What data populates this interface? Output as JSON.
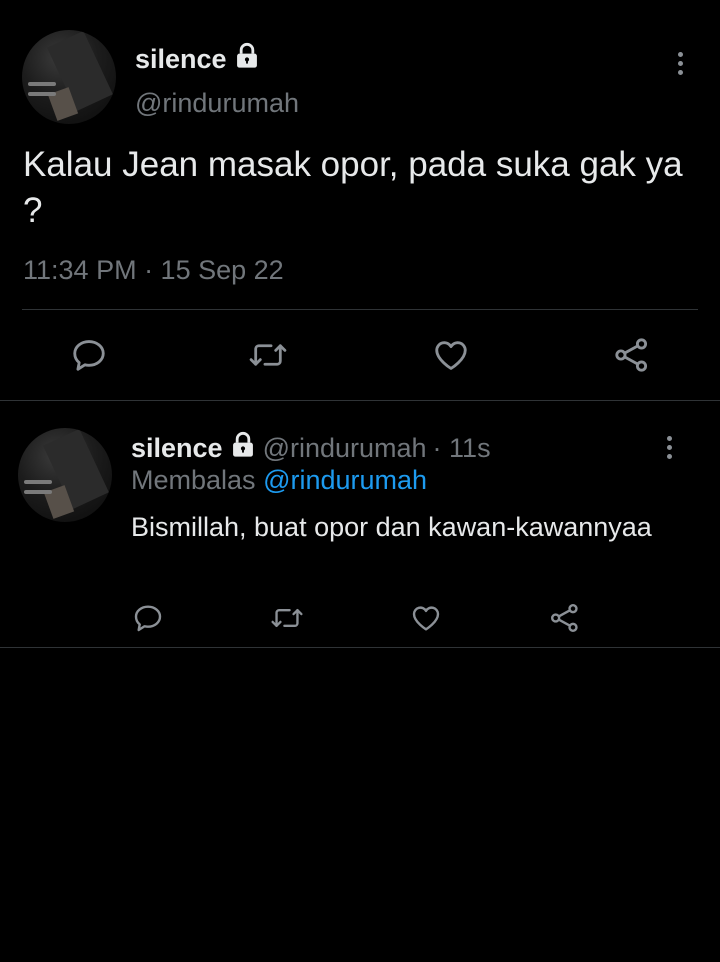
{
  "main_tweet": {
    "display_name": "silence",
    "handle": "@rindurumah",
    "text": "Kalau Jean masak opor, pada suka gak ya ?",
    "timestamp": "11:34 PM · 15 Sep 22",
    "icons": {
      "protected": "lock-icon",
      "more": "more-vertical-icon",
      "reply": "reply-icon",
      "retweet": "retweet-icon",
      "like": "like-icon",
      "share": "share-icon"
    }
  },
  "reply": {
    "display_name": "silence",
    "handle": "@rindurumah",
    "time_ago": "· 11s",
    "replying_label": "Membalas",
    "replying_to": "@rindurumah",
    "text": "Bismillah, buat opor dan kawan-kawannyaa"
  },
  "colors": {
    "background": "#000000",
    "text_primary": "#e7e9ea",
    "text_secondary": "#71767b",
    "accent": "#1d9bf0",
    "divider": "#2f3336"
  }
}
